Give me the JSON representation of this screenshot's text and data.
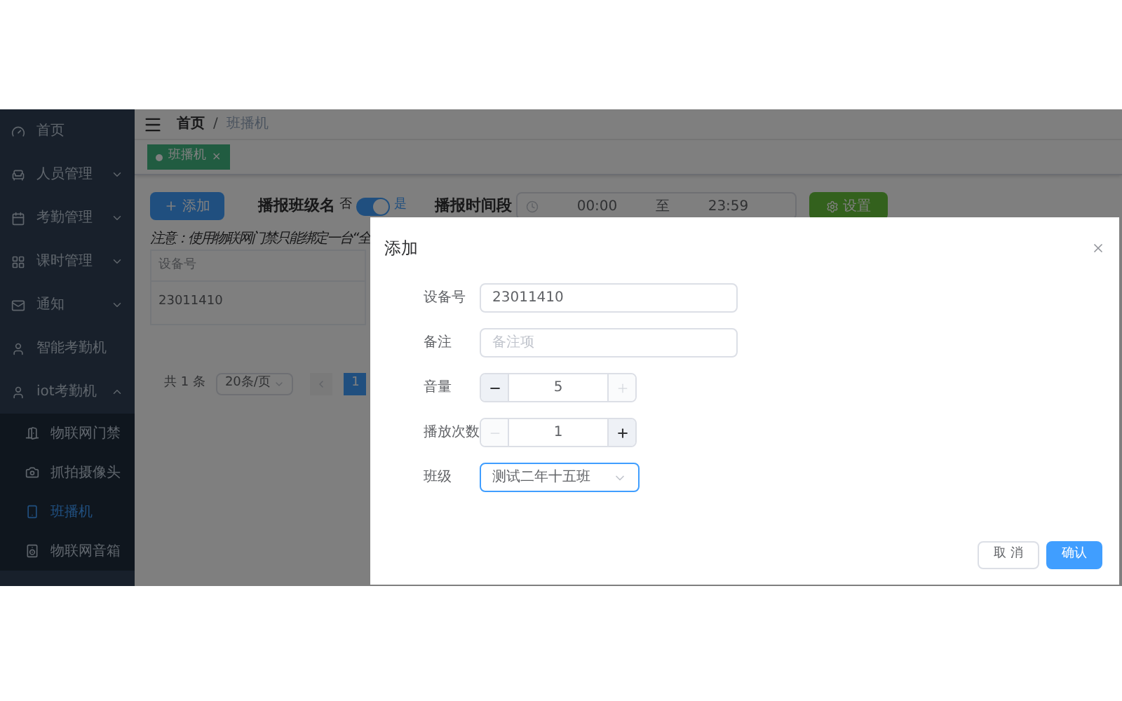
{
  "sidebar": {
    "items": [
      {
        "label": "首页"
      },
      {
        "label": "人员管理",
        "expanded": false
      },
      {
        "label": "考勤管理",
        "expanded": false
      },
      {
        "label": "课时管理",
        "expanded": false
      },
      {
        "label": "通知",
        "expanded": false
      },
      {
        "label": "智能考勤机"
      },
      {
        "label": "iot考勤机",
        "expanded": true,
        "children": [
          {
            "label": "物联网门禁",
            "selected": false
          },
          {
            "label": "抓拍摄像头",
            "selected": false
          },
          {
            "label": "班播机",
            "selected": true
          },
          {
            "label": "物联网音箱",
            "selected": false
          }
        ]
      }
    ]
  },
  "breadcrumb": {
    "separator": "/",
    "items": [
      "首页",
      "班播机"
    ]
  },
  "tags": [
    {
      "label": "班播机",
      "close": "×",
      "selected": true
    }
  ],
  "toolbar": {
    "add_button": "添加",
    "announce": {
      "label": "播报班级名",
      "off_label": "否",
      "on_label": "是",
      "on": true
    },
    "time_range": {
      "label": "播报时间段",
      "start": "00:00",
      "separator": "至",
      "end": "23:59"
    },
    "settings_button": "设置"
  },
  "notice": "注意：使用物联网门禁只能绑定一台“全",
  "table": {
    "columns": [
      "设备号"
    ],
    "rows": [
      [
        "23011410"
      ]
    ]
  },
  "pagination": {
    "total": "共 1 条",
    "page_size": "20条/页",
    "pages": [
      {
        "label": "1",
        "selected": true
      }
    ]
  },
  "dialog": {
    "title": "添加",
    "fields": [
      {
        "kind": "text",
        "label": "设备号",
        "value": "23011410"
      },
      {
        "kind": "text",
        "label": "备注",
        "placeholder": "备注项"
      },
      {
        "kind": "stepper",
        "label": "音量",
        "value": "5",
        "minus_disabled": false,
        "plus_disabled": true
      },
      {
        "kind": "stepper",
        "label": "播放次数",
        "value": "1",
        "minus_disabled": true,
        "plus_disabled": false
      },
      {
        "kind": "select",
        "label": "班级",
        "value": "测试二年十五班",
        "focused": true
      }
    ],
    "cancel_button": "取 消",
    "confirm_button": "确认"
  }
}
